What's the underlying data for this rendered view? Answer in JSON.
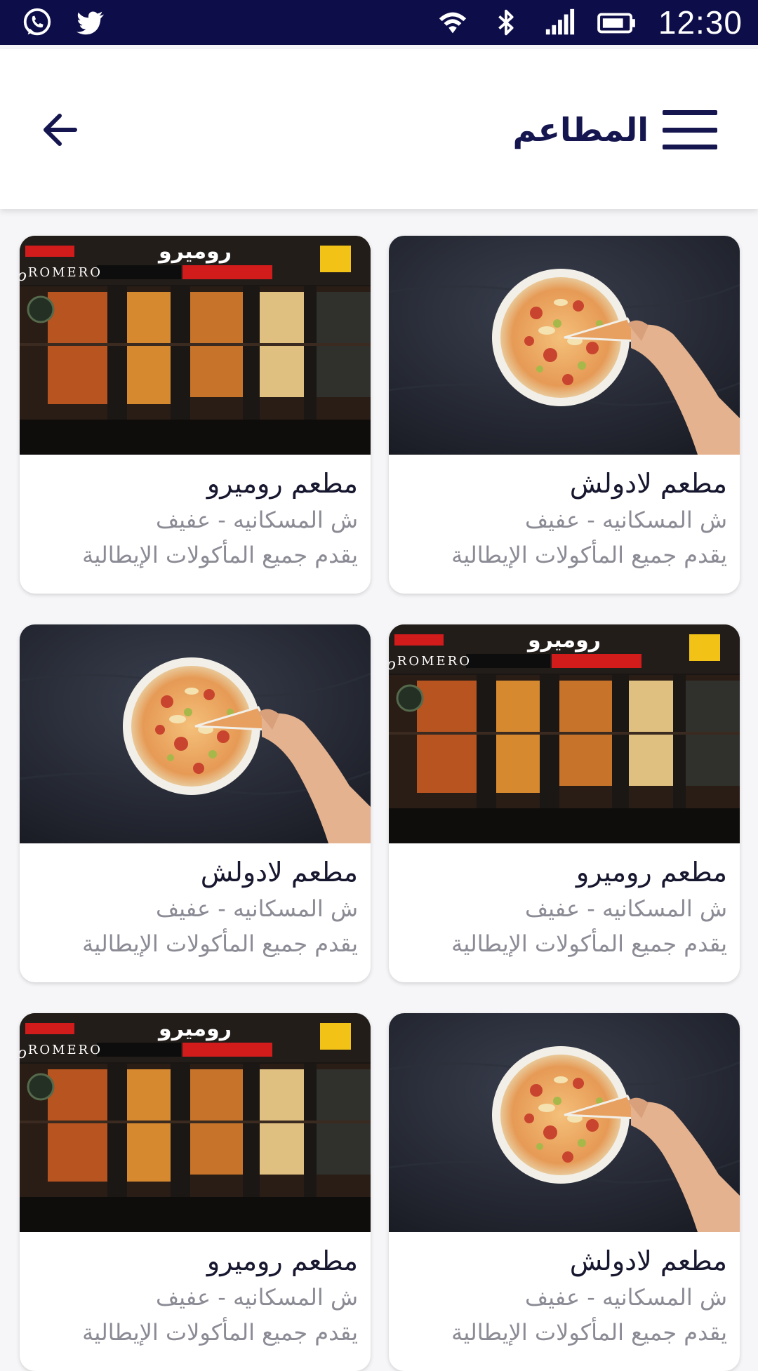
{
  "status_bar": {
    "time": "12:30",
    "left_icons": [
      "whatsapp-icon",
      "twitter-icon"
    ],
    "right_icons": [
      "wifi-icon",
      "bluetooth-icon",
      "signal-icon",
      "battery-icon"
    ]
  },
  "header": {
    "title": "المطاعم",
    "back_icon": "arrow-left-icon",
    "menu_icon": "hamburger-menu-icon"
  },
  "colors": {
    "status_bar": "#0d0d4a",
    "primary_text": "#15154f",
    "secondary_text": "#8b8b95"
  },
  "restaurants": [
    {
      "name": "مطعم لادولش",
      "address": "ش المسكانيه - عفيف",
      "description": "يقدم جميع المأكولات الإيطالية",
      "image": "pizza"
    },
    {
      "name": "مطعم روميرو",
      "address": "ش المسكانيه - عفيف",
      "description": "يقدم جميع المأكولات الإيطالية",
      "image": "storefront",
      "image_sign": "ROMERO",
      "image_sign_ar": "روميرو"
    },
    {
      "name": "مطعم روميرو",
      "address": "ش المسكانيه - عفيف",
      "description": "يقدم جميع المأكولات الإيطالية",
      "image": "storefront",
      "image_sign": "ROMERO",
      "image_sign_ar": "روميرو"
    },
    {
      "name": "مطعم لادولش",
      "address": "ش المسكانيه - عفيف",
      "description": "يقدم جميع المأكولات الإيطالية",
      "image": "pizza"
    },
    {
      "name": "مطعم لادولش",
      "address": "ش المسكانيه - عفيف",
      "description": "يقدم جميع المأكولات الإيطالية",
      "image": "pizza"
    },
    {
      "name": "مطعم روميرو",
      "address": "ش المسكانيه - عفيف",
      "description": "يقدم جميع المأكولات الإيطالية",
      "image": "storefront",
      "image_sign": "ROMERO",
      "image_sign_ar": "روميرو"
    }
  ]
}
